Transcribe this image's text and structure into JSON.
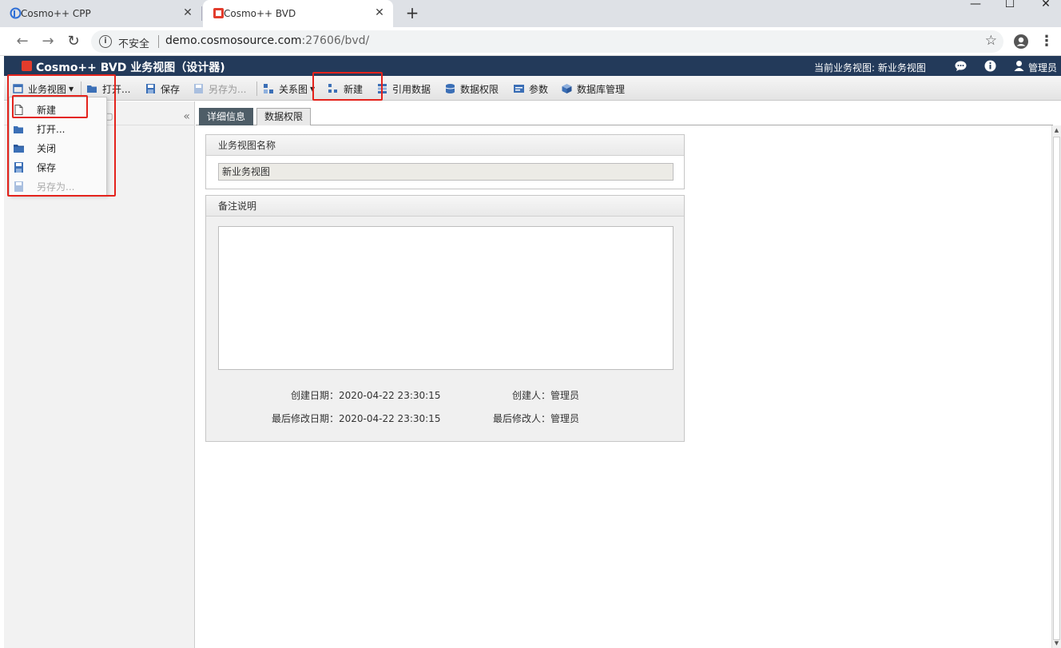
{
  "browser": {
    "tabs": [
      {
        "title": "Cosmo++ CPP",
        "active": false
      },
      {
        "title": "Cosmo++ BVD",
        "active": true
      }
    ],
    "new_tab": "+",
    "window_controls": {
      "minimize": "—",
      "maximize": "☐",
      "close": "✕"
    },
    "security_label": "不安全",
    "url_host": "demo.cosmosource.com",
    "url_rest": ":27606/bvd/"
  },
  "app": {
    "title": "Cosmo++ BVD 业务视图（设计器)",
    "current_view": "当前业务视图: 新业务视图",
    "user": "管理员",
    "brand_color": "#233a5a",
    "accent_color": "#e23c2c"
  },
  "toolbar": {
    "business_view": "业务视图",
    "open": "打开...",
    "save": "保存",
    "save_as": "另存为...",
    "relation": "关系图",
    "new": "新建",
    "reference_data": "引用数据",
    "data_permission": "数据权限",
    "params": "参数",
    "db_manage": "数据库管理"
  },
  "menu": {
    "items": [
      {
        "label": "新建",
        "icon": "file-icon",
        "enabled": true
      },
      {
        "label": "打开...",
        "icon": "folder-open-icon",
        "enabled": true
      },
      {
        "label": "关闭",
        "icon": "folder-close-icon",
        "enabled": true
      },
      {
        "label": "保存",
        "icon": "save-icon",
        "enabled": true
      },
      {
        "label": "另存为...",
        "icon": "save-as-icon",
        "enabled": false
      }
    ]
  },
  "left_panel": {
    "collapse": "«"
  },
  "panel_tabs": {
    "detail": "详细信息",
    "permission": "数据权限"
  },
  "form": {
    "name_section": "业务视图名称",
    "name_value": "新业务视图",
    "remark_section": "备注说明",
    "remark_value": "",
    "created_date_label": "创建日期：",
    "created_date": "2020-04-22 23:30:15",
    "creator_label": "创建人：",
    "creator": "管理员",
    "modified_date_label": "最后修改日期：",
    "modified_date": "2020-04-22 23:30:15",
    "modifier_label": "最后修改人：",
    "modifier": "管理员"
  }
}
